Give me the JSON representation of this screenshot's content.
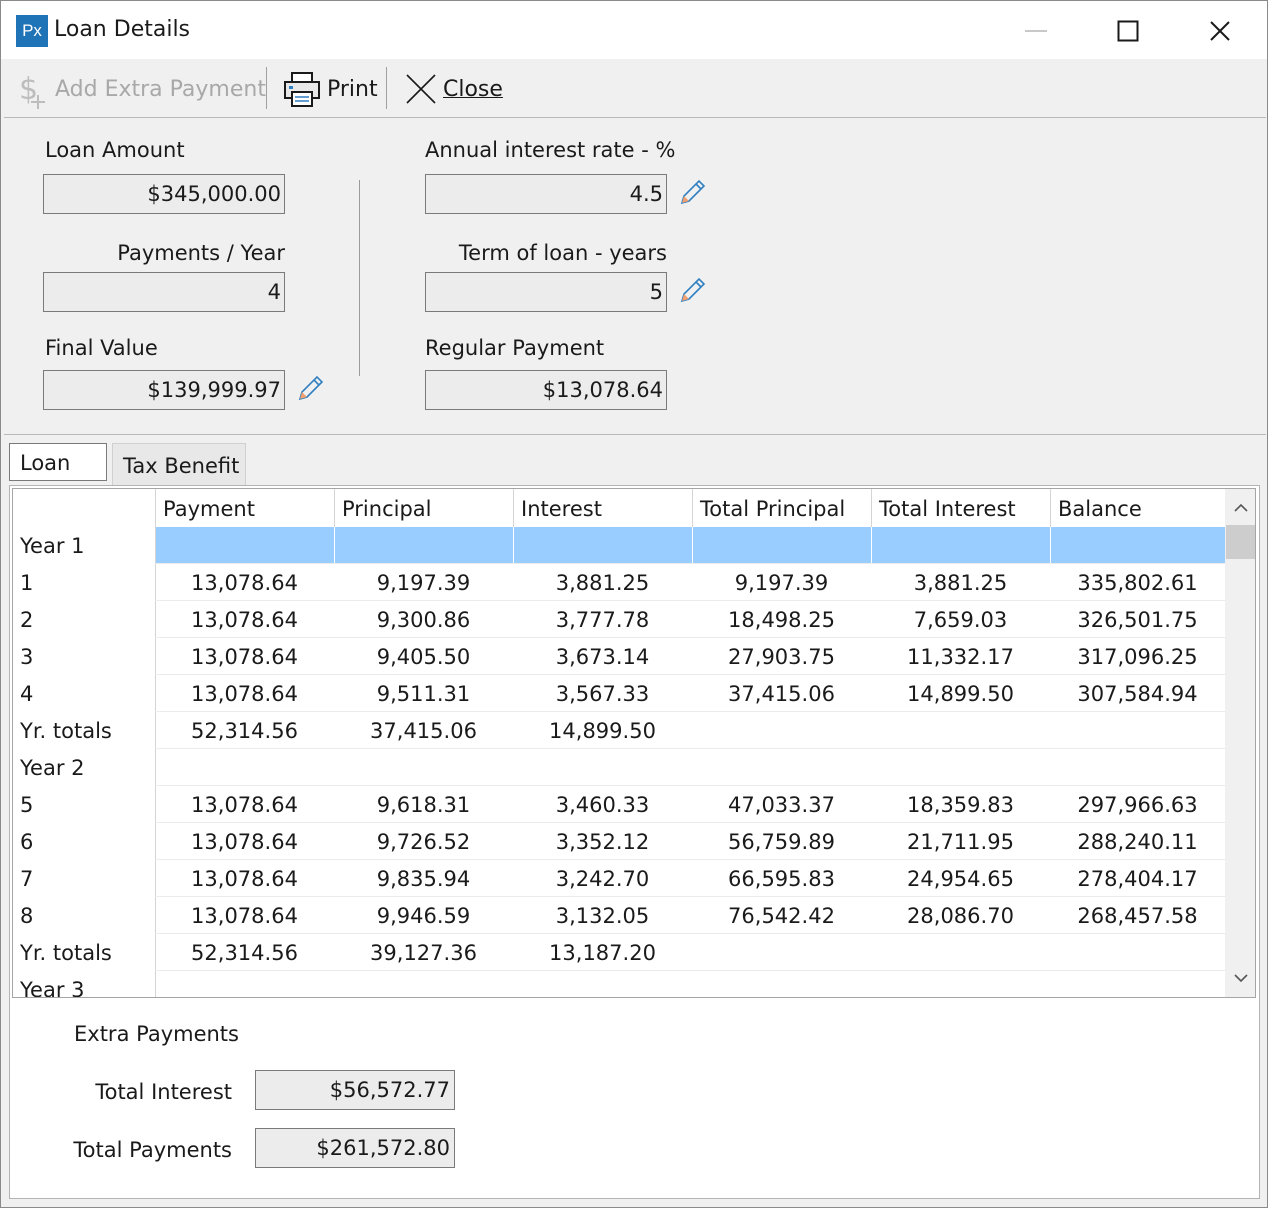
{
  "window": {
    "app_icon": "Px",
    "title": "Loan Details"
  },
  "toolbar": {
    "add_extra_payment": "Add Extra Payment",
    "print": "Print",
    "close": "Close"
  },
  "fields": {
    "loan_amount_label": "Loan Amount",
    "loan_amount": "$345,000.00",
    "payments_per_year_label": "Payments / Year",
    "payments_per_year": "4",
    "final_value_label": "Final Value",
    "final_value": "$139,999.97",
    "interest_rate_label": "Annual interest rate - %",
    "interest_rate": "4.5",
    "term_label": "Term of loan - years",
    "term": "5",
    "regular_payment_label": "Regular Payment",
    "regular_payment": "$13,078.64"
  },
  "tabs": {
    "loan": "Loan",
    "tax_benefit": "Tax Benefit"
  },
  "grid": {
    "columns": [
      "Payment",
      "Principal",
      "Interest",
      "Total Principal",
      "Total Interest",
      "Balance"
    ],
    "rows": [
      {
        "label": "Year 1",
        "cells": [
          "",
          "",
          "",
          "",
          "",
          ""
        ]
      },
      {
        "label": "1",
        "cells": [
          "13,078.64",
          "9,197.39",
          "3,881.25",
          "9,197.39",
          "3,881.25",
          "335,802.61"
        ]
      },
      {
        "label": "2",
        "cells": [
          "13,078.64",
          "9,300.86",
          "3,777.78",
          "18,498.25",
          "7,659.03",
          "326,501.75"
        ]
      },
      {
        "label": "3",
        "cells": [
          "13,078.64",
          "9,405.50",
          "3,673.14",
          "27,903.75",
          "11,332.17",
          "317,096.25"
        ]
      },
      {
        "label": "4",
        "cells": [
          "13,078.64",
          "9,511.31",
          "3,567.33",
          "37,415.06",
          "14,899.50",
          "307,584.94"
        ]
      },
      {
        "label": "Yr. totals",
        "cells": [
          "52,314.56",
          "37,415.06",
          "14,899.50",
          "",
          "",
          ""
        ]
      },
      {
        "label": "Year 2",
        "cells": [
          "",
          "",
          "",
          "",
          "",
          ""
        ]
      },
      {
        "label": "5",
        "cells": [
          "13,078.64",
          "9,618.31",
          "3,460.33",
          "47,033.37",
          "18,359.83",
          "297,966.63"
        ]
      },
      {
        "label": "6",
        "cells": [
          "13,078.64",
          "9,726.52",
          "3,352.12",
          "56,759.89",
          "21,711.95",
          "288,240.11"
        ]
      },
      {
        "label": "7",
        "cells": [
          "13,078.64",
          "9,835.94",
          "3,242.70",
          "66,595.83",
          "24,954.65",
          "278,404.17"
        ]
      },
      {
        "label": "8",
        "cells": [
          "13,078.64",
          "9,946.59",
          "3,132.05",
          "76,542.42",
          "28,086.70",
          "268,457.58"
        ]
      },
      {
        "label": "Yr. totals",
        "cells": [
          "52,314.56",
          "39,127.36",
          "13,187.20",
          "",
          "",
          ""
        ]
      },
      {
        "label": "Year 3",
        "cells": [
          "",
          "",
          "",
          "",
          "",
          ""
        ]
      }
    ]
  },
  "summary": {
    "extra_payments_label": "Extra Payments",
    "total_interest_label": "Total Interest",
    "total_interest": "$56,572.77",
    "total_payments_label": "Total Payments",
    "total_payments": "$261,572.80"
  },
  "colors": {
    "selection": "#99ccff",
    "app_icon_bg": "#1f73b7",
    "pencil": "#2f7fc1"
  }
}
